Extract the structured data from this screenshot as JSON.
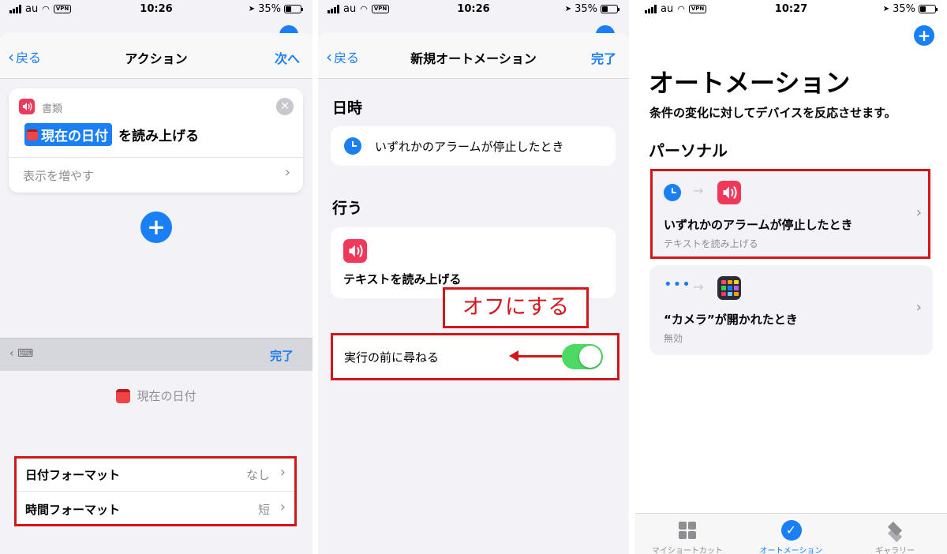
{
  "status": {
    "carrier": "au",
    "vpn": "VPN",
    "battery": "35%",
    "time1": "10:26",
    "time2": "10:26",
    "time3": "10:27"
  },
  "screen1": {
    "nav": {
      "back": "戻る",
      "title": "アクション",
      "next": "次へ"
    },
    "action_card": {
      "category": "書類",
      "token": "現在の日付",
      "action_text": "を読み上げる",
      "show_more": "表示を増やす"
    },
    "keyboard_bar": {
      "done": "完了"
    },
    "detail": {
      "title": "現在の日付",
      "rows": [
        {
          "label": "日付フォーマット",
          "value": "なし"
        },
        {
          "label": "時間フォーマット",
          "value": "短"
        }
      ]
    }
  },
  "screen2": {
    "nav": {
      "back": "戻る",
      "title": "新規オートメーション",
      "done": "完了"
    },
    "when_header": "日時",
    "trigger_text": "いずれかのアラームが停止したとき",
    "do_header": "行う",
    "action_text": "テキストを読み上げる",
    "annotation": "オフにする",
    "ask_label": "実行の前に尋ねる",
    "ask_toggle_on": true
  },
  "screen3": {
    "title": "オートメーション",
    "subtitle": "条件の変化に対してデバイスを反応させます。",
    "section": "パーソナル",
    "items": [
      {
        "title": "いずれかのアラームが停止したとき",
        "sub": "テキストを読み上げる"
      },
      {
        "title": "“カメラ”が開かれたとき",
        "sub": "無効"
      }
    ],
    "tabs": [
      {
        "label": "マイショートカット",
        "icon": "grid-icon"
      },
      {
        "label": "オートメーション",
        "icon": "check-circle-icon"
      },
      {
        "label": "ギャラリー",
        "icon": "layers-icon"
      }
    ]
  },
  "colors": {
    "accent": "#1a7ef5",
    "highlight": "#d0181c",
    "toggle_on": "#4cd964",
    "speaker": "#f0385b"
  }
}
